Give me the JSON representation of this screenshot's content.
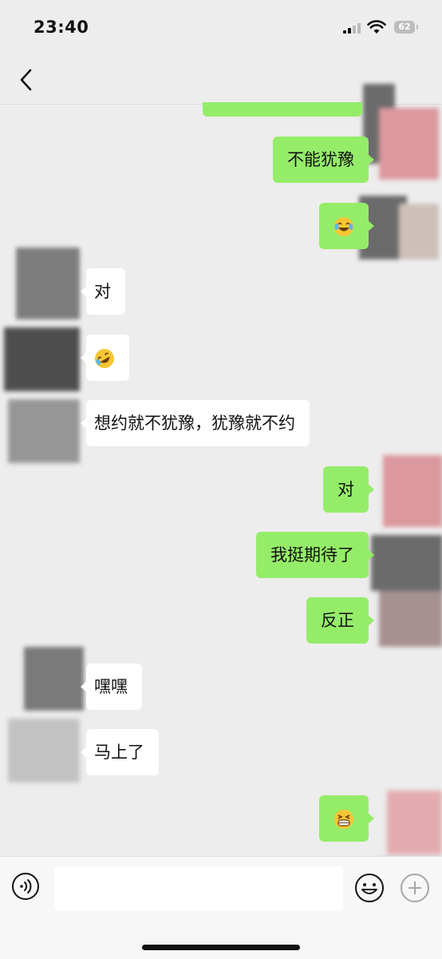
{
  "status_bar": {
    "time": "23:40",
    "battery": "62"
  },
  "nav": {
    "back_icon": "chevron-left-icon"
  },
  "messages": [
    {
      "side": "me",
      "text": "不能犹豫"
    },
    {
      "side": "me",
      "emoji": "laughing-tears-emoji"
    },
    {
      "side": "them",
      "text": "对"
    },
    {
      "side": "them",
      "emoji": "rolling-laughing-emoji"
    },
    {
      "side": "them",
      "text": "想约就不犹豫，犹豫就不约"
    },
    {
      "side": "me",
      "text": "对"
    },
    {
      "side": "me",
      "text": "我挺期待了"
    },
    {
      "side": "me",
      "text": "反正"
    },
    {
      "side": "them",
      "text": "嘿嘿"
    },
    {
      "side": "them",
      "text": "马上了"
    },
    {
      "side": "me",
      "emoji": "grinning-squint-emoji"
    }
  ],
  "input_bar": {
    "text_value": "",
    "voice_icon": "voice-icon",
    "emoji_icon": "smiley-icon",
    "plus_icon": "plus-circle-icon"
  },
  "colors": {
    "my_bubble": "#95ec69",
    "their_bubble": "#ffffff",
    "background": "#ededed"
  }
}
